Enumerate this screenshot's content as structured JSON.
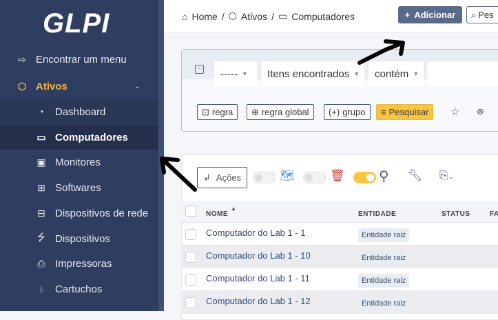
{
  "sidebar": {
    "logo": "GLPI",
    "find_menu": "Encontrar um menu",
    "section": "Ativos",
    "items": [
      {
        "label": "Dashboard",
        "icon": "gauge-icon"
      },
      {
        "label": "Computadores",
        "icon": "laptop-icon"
      },
      {
        "label": "Monitores",
        "icon": "monitor-icon"
      },
      {
        "label": "Softwares",
        "icon": "apps-icon"
      },
      {
        "label": "Dispositivos de rede",
        "icon": "network-icon"
      },
      {
        "label": "Dispositivos",
        "icon": "usb-icon"
      },
      {
        "label": "Impressoras",
        "icon": "printer-icon"
      },
      {
        "label": "Cartuchos",
        "icon": "droplet-icon"
      }
    ]
  },
  "breadcrumb": [
    "Home",
    "/",
    "Ativos",
    "/",
    "Computadores"
  ],
  "header": {
    "add": "Adicionar",
    "search": "Pes"
  },
  "search": {
    "field1": "-----",
    "field2": "Itens encontrados",
    "operator": "contém",
    "value": "",
    "rule": "regra",
    "global_rule": "regra global",
    "group": "grupo",
    "submit": "Pesquisar"
  },
  "toolbar": {
    "actions": "Ações"
  },
  "table": {
    "columns": [
      "NOME",
      "ENTIDADE",
      "STATUS",
      "FA"
    ],
    "rows": [
      {
        "name": "Computador do Lab 1 - 1",
        "entity": "Entidade raiz"
      },
      {
        "name": "Computador do Lab 1 - 10",
        "entity": "Entidade raiz"
      },
      {
        "name": "Computador do Lab 1 - 11",
        "entity": "Entidade raiz"
      },
      {
        "name": "Computador do Lab 1 - 12",
        "entity": "Entidade raiz"
      }
    ]
  },
  "colors": {
    "sidebar": "#2e3d60",
    "accent": "#f8c543",
    "section": "#f5b342"
  }
}
